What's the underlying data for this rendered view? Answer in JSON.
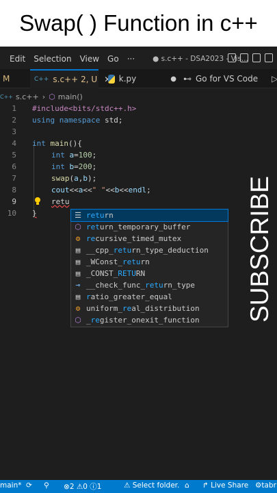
{
  "banner": {
    "title": "Swap( ) Function in c++"
  },
  "menubar": {
    "items": [
      "Edit",
      "Selection",
      "View",
      "Go",
      "···"
    ],
    "window_title": "● s.c++ - DSA2023 - Vis..."
  },
  "tabs": [
    {
      "label": "M"
    },
    {
      "label": "s.c++",
      "status": "2, U",
      "icon": "cpp-icon",
      "active": true
    },
    {
      "label": "k.py",
      "icon": "python-icon",
      "modified": true
    },
    {
      "label": "Go for VS Code",
      "icon": "go-icon"
    }
  ],
  "breadcrumb": {
    "file": "s.c++",
    "symbol": "main()"
  },
  "editor": {
    "line_numbers": [
      "1",
      "2",
      "3",
      "4",
      "5",
      "6",
      "7",
      "8",
      "9",
      "10"
    ],
    "lines": {
      "l1": "#include<bits/stdc++.h>",
      "l2a": "using ",
      "l2b": "namespace",
      "l2c": " std;",
      "l4a": "int ",
      "l4b": "main",
      "l4c": "(){",
      "l5a": "int ",
      "l5b": "a",
      "l5c": "=",
      "l5d": "100",
      "l5e": ";",
      "l6a": "int ",
      "l6b": "b",
      "l6c": "=",
      "l6d": "200",
      "l6e": ";",
      "l7a": "swap",
      "l7b": "(",
      "l7c": "a",
      "l7d": ",",
      "l7e": "b",
      "l7f": ");",
      "l8a": "cout",
      "l8b": "<<",
      "l8c": "a",
      "l8d": "<<",
      "l8e": "\" \"",
      "l8f": "<<",
      "l8g": "b",
      "l8h": "<<",
      "l8i": "endl",
      "l8j": ";",
      "l9": "retu",
      "l10": "}"
    }
  },
  "suggestions": [
    {
      "pre": "",
      "match": "retu",
      "post": "rn",
      "icon": "keyword-icon"
    },
    {
      "pre": "",
      "match": "ret",
      "post": "urn_temporary_buffer",
      "icon": "function-icon"
    },
    {
      "pre": "",
      "match": "re",
      "post": "cursive_timed_mutex",
      "icon": "class-icon"
    },
    {
      "pre": "__cpp_",
      "match": "retu",
      "post": "rn_type_deduction",
      "icon": "text-icon"
    },
    {
      "pre": "_WConst_",
      "match": "retu",
      "post": "rn",
      "icon": "text-icon"
    },
    {
      "pre": "_CONST_",
      "match": "RETU",
      "post": "RN",
      "icon": "text-icon"
    },
    {
      "pre": "__check_func_",
      "match": "retu",
      "post": "rn_type",
      "icon": "field-icon"
    },
    {
      "pre": "",
      "match": "r",
      "post": "atio_greater_equal",
      "icon": "text-icon"
    },
    {
      "pre": "uniform_",
      "match": "re",
      "post": "al_distribution",
      "icon": "class-icon"
    },
    {
      "pre": "_",
      "match": "re",
      "post": "gister_onexit_function",
      "icon": "function-icon"
    }
  ],
  "overlay": {
    "subscribe": "SUBSCRIBE"
  },
  "statusbar": {
    "branch": "main*",
    "errors": "2",
    "warnings": "0",
    "info": "1",
    "select_folder": "Select folder.",
    "live_share": "Live Share",
    "tab_label": "tabr"
  }
}
